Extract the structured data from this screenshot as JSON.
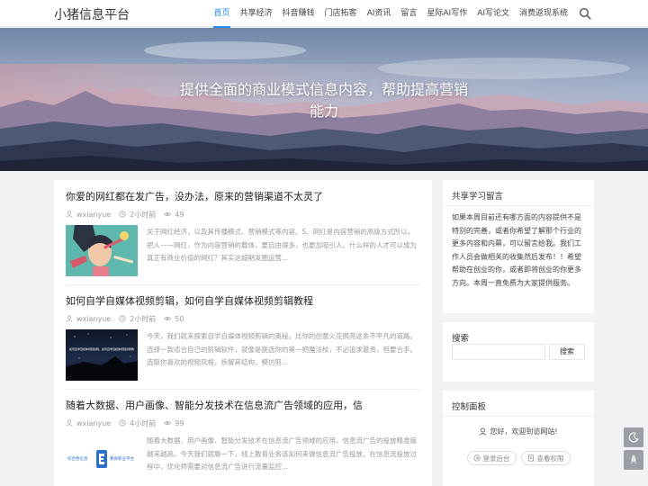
{
  "header": {
    "site_title": "小猪信息平台",
    "nav": [
      "首页",
      "共享经济",
      "抖音赚钱",
      "门店拓客",
      "AI资讯",
      "留言",
      "星际AI写作",
      "AI写论文",
      "消费返现系统"
    ]
  },
  "hero": {
    "line1": "提供全面的商业模式信息内容，帮助提高营销",
    "line2": "能力"
  },
  "posts": [
    {
      "title": "你爱的网红都在发广告，没办法，原来的营销渠道不太灵了",
      "author": "wxianyue",
      "time": "2小时前",
      "views": "49",
      "excerpt": "关于网红经济，以及其传播模式、营销模式等内容。S、网红是内容营销的高级方式所以，把人——网红，作为内容营销的载体，要自由得多，也更加吸引人。什么样的人才可以成为真正有商业价值的网红？其实这超期发圈运营..."
    },
    {
      "title": "如何自学自媒体视频剪辑，如何自学自媒体视频剪辑教程",
      "author": "wxianyue",
      "time": "2小时前",
      "views": "50",
      "excerpt": "今天，我们就来探索自学自媒体视频剪辑的奥秘。比你的创意火花照亮这条不平凡的道路。选择一款适合自己的剪辑软件，就像是挑选你的第一把魔法杖，不必追求最贵，但要合手。选取你喜欢的视频风格，拆解其结构，模仿剪..."
    },
    {
      "title": "随着大数据、用户画像、智能分发技术在信息流广告领域的应用，信",
      "author": "wxianyue",
      "time": "4小时前",
      "views": "99",
      "excerpt": "随着大数据、用户画像、智能分发技术在信息流广告领域的应用，信息流广告的投放精准度越来越高。今天我们就聊一下，线上教育业务该如何来做信息流广告投放。在信息流投放过程中，优化师需要对信息流广告进行流量监控..."
    }
  ],
  "thumb2_caption": "如何自学自媒体视频剪辑，如何自学自媒体视频剪辑教程",
  "thumb3_text": [
    "综合性信息",
    "教育职业平台"
  ],
  "sidebar": {
    "notice_title": "共享学习留言",
    "notice_text": "如果本周目前还有哪方面的内容提供不是特别的完善，或者你希望了解那个行业的更多内容和内幕，可以留言给我。我们工作人员会做相关的收集然后发布！！希望帮助在创业的你，或者即将创业的你更多方向。本周一直免费为大家提供服务。",
    "search_title": "搜索",
    "search_button": "搜索",
    "control_title": "控制面板",
    "welcome": "您好，欢迎到访网站!",
    "login_button": "登录后台",
    "perm_button": "查看权限"
  },
  "colors": {
    "accent": "#2d8cf0",
    "background": "#f1f2f4",
    "float_button": "#9aa0a6"
  }
}
